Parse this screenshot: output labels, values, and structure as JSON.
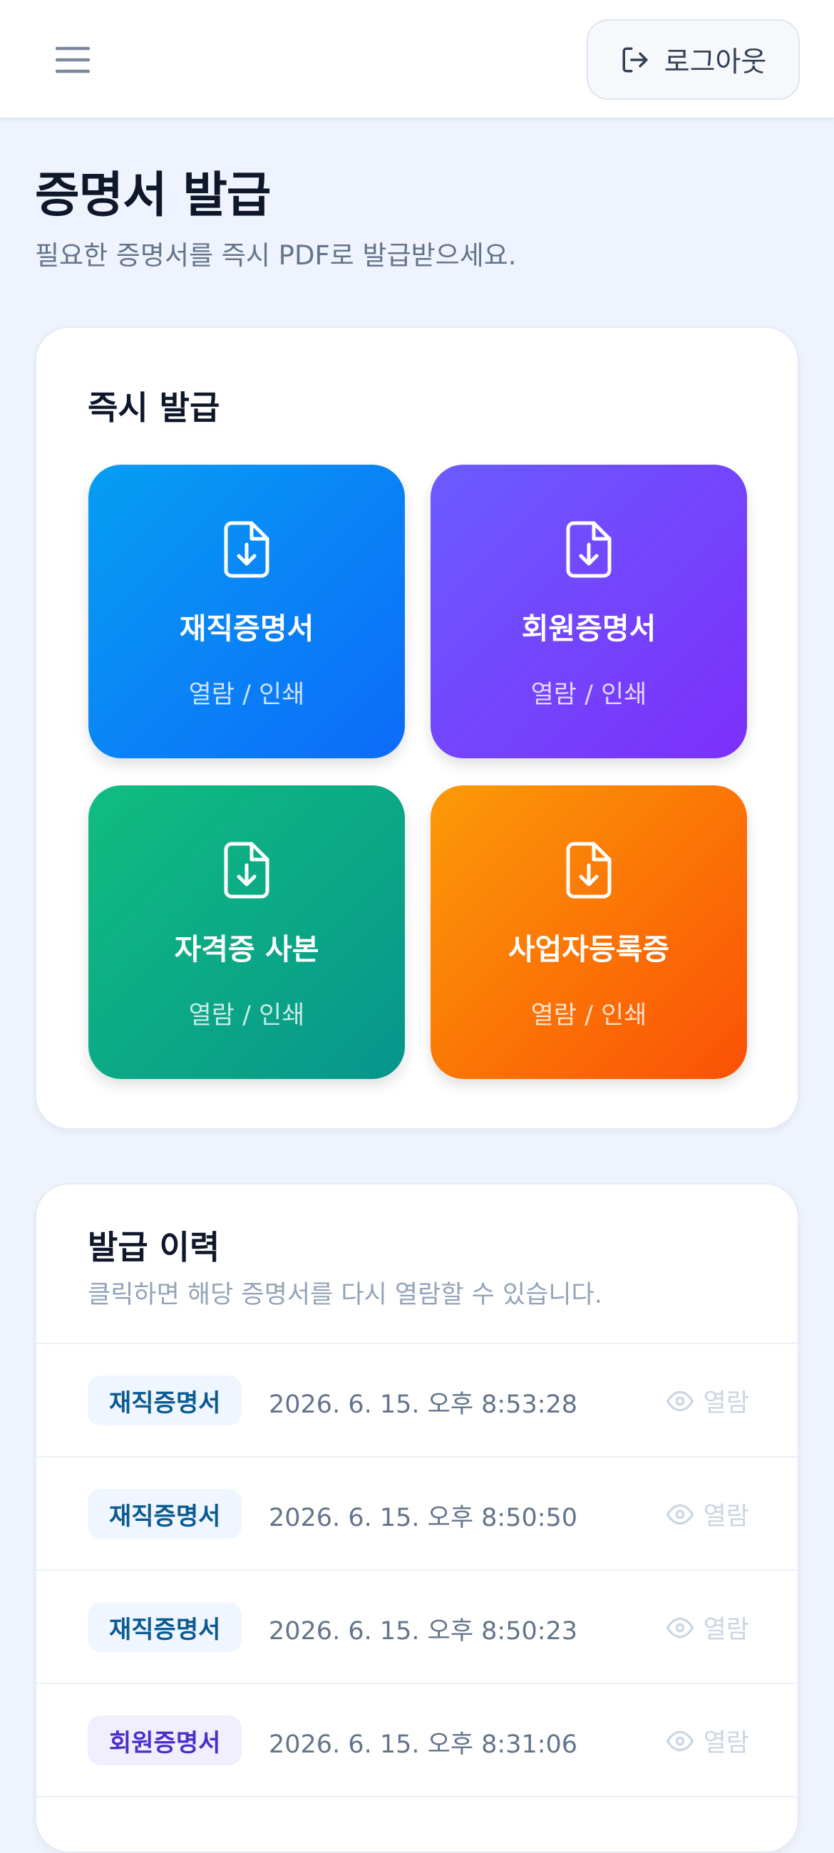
{
  "header": {
    "menu_icon": "hamburger-menu-icon",
    "logout_label": "로그아웃",
    "logout_icon": "log-out-icon"
  },
  "page": {
    "title": "증명서 발급",
    "subtitle": "필요한 증명서를 즉시 PDF로 발급받으세요."
  },
  "issue": {
    "title": "즉시 발급",
    "tiles": [
      {
        "name": "재직증명서",
        "action": "열람 / 인쇄",
        "icon": "file-download-icon",
        "color": "#0a84f6"
      },
      {
        "name": "회원증명서",
        "action": "열람 / 인쇄",
        "icon": "file-download-icon",
        "color": "#7245fd"
      },
      {
        "name": "자격증 사본",
        "action": "열람 / 인쇄",
        "icon": "file-download-icon",
        "color": "#0caa86"
      },
      {
        "name": "사업자등록증",
        "action": "열람 / 인쇄",
        "icon": "file-download-icon",
        "color": "#fb7606"
      }
    ]
  },
  "history": {
    "title": "발급 이력",
    "subtitle": "클릭하면 해당 증명서를 다시 열람할 수 있습니다.",
    "rows": [
      {
        "type": "재직증명서",
        "time": "2026. 6. 15. 오후 8:53:28",
        "view": "열람"
      },
      {
        "type": "재직증명서",
        "time": "2026. 6. 15. 오후 8:50:50",
        "view": "열람"
      },
      {
        "type": "재직증명서",
        "time": "2026. 6. 15. 오후 8:50:23",
        "view": "열람"
      },
      {
        "type": "회원증명서",
        "time": "2026. 6. 15. 오후 8:31:06",
        "view": "열람"
      }
    ]
  },
  "colors": {
    "background": "#eef3fd",
    "badge_blue_text": "#0b5a91",
    "badge_purple_text": "#4c2fc9"
  }
}
